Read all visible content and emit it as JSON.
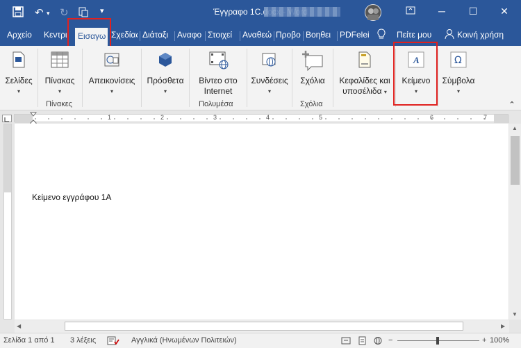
{
  "window": {
    "title": "Έγγραφο 1C.docx  -  Word",
    "minimize": "─",
    "maximize": "☐",
    "close": "✕",
    "restore": "▭"
  },
  "tabs": [
    "Αρχείο",
    "Κεντρι",
    "Εισαγω",
    "Σχεδίας",
    "Διάταξι",
    "Αναφο",
    "Στοιχεί",
    "Αναθεώ",
    "Προβο",
    "Βοηθει",
    "PDFelei"
  ],
  "tell_me": "Πείτε μου",
  "share": "Κοινή χρήση",
  "ribbon": {
    "pages": "Σελίδες",
    "tables": "Πίνακας",
    "tables_group": "Πίνακες",
    "illustrations": "Απεικονίσεις",
    "addins": "Πρόσθετα",
    "video_line1": "Βίντεο στο",
    "video_line2": "Internet",
    "media_group": "Πολυμέσα",
    "links": "Συνδέσεις",
    "comment": "Σχόλια",
    "comments_group": "Σχόλια",
    "header_line1": "Κεφαλίδες και",
    "header_line2": "υποσέλιδα",
    "text": "Κείμενο",
    "symbols": "Σύμβολα"
  },
  "ruler_numbers": [
    "1",
    "2",
    "3",
    "4",
    "5",
    "6",
    "7"
  ],
  "document": {
    "text": "Κείμενο εγγράφου 1Α"
  },
  "status": {
    "page": "Σελίδα 1 από 1",
    "words": "3 λέξεις",
    "language": "Αγγλικά (Ηνωμένων Πολιτειών)",
    "zoom": "100%"
  },
  "colors": {
    "accent": "#2b579a",
    "highlight": "#e0211f"
  }
}
